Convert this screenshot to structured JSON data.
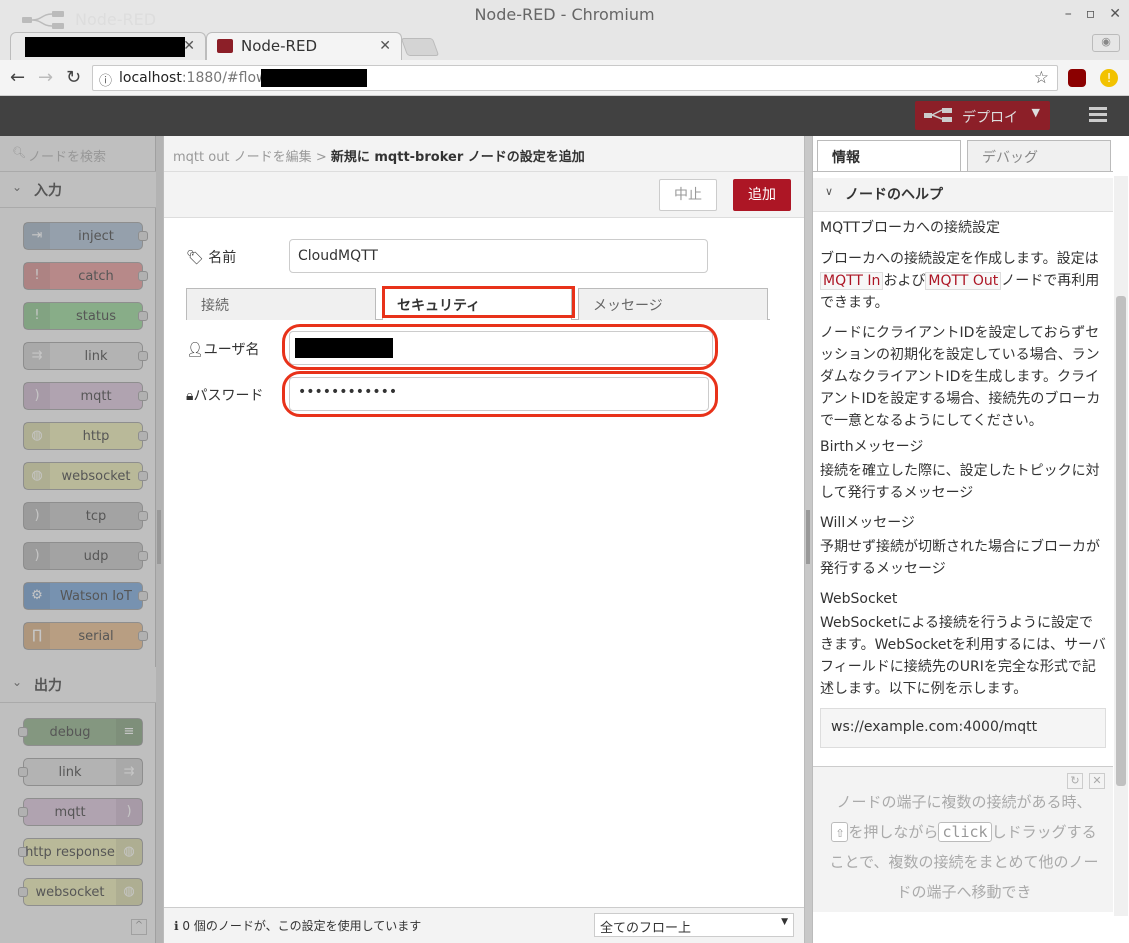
{
  "window": {
    "title": "Node-RED - Chromium"
  },
  "tabs": [
    {
      "label": ""
    },
    {
      "label": "Node-RED"
    }
  ],
  "address": {
    "url_host": "localhost",
    "url_rest": ":1880/#flow/"
  },
  "header": {
    "title": "Node-RED",
    "deploy_label": "デプロイ"
  },
  "palette": {
    "search_placeholder": "ノードを検索",
    "cat_input": "入力",
    "cat_output": "出力",
    "input_nodes": [
      "inject",
      "catch",
      "status",
      "link",
      "mqtt",
      "http",
      "websocket",
      "tcp",
      "udp",
      "Watson IoT",
      "serial"
    ],
    "output_nodes": [
      "debug",
      "link",
      "mqtt",
      "http response",
      "websocket"
    ]
  },
  "tray": {
    "breadcrumb_prev": "mqtt out ノードを編集",
    "breadcrumb_sep": ">",
    "breadcrumb_current": "新規に mqtt-broker ノードの設定を追加",
    "cancel_label": "中止",
    "add_label": "追加",
    "name_label": "名前",
    "name_value": "CloudMQTT",
    "tabs": [
      "接続",
      "セキュリティ",
      "メッセージ"
    ],
    "username_label": "ユーザ名",
    "password_label": "パスワード",
    "password_value": "••••••••••••",
    "footer_text": "0 個のノードが、この設定を使用しています",
    "scope_value": "全てのフロー上"
  },
  "sidebar": {
    "tab_info": "情報",
    "tab_debug": "デバッグ",
    "help_header": "ノードのヘルプ",
    "help_title": "MQTTブローカへの接続設定",
    "help_p1_a": "ブローカへの接続設定を作成します。設定は",
    "help_p1_code1": "MQTT In",
    "help_p1_b": "および",
    "help_p1_code2": "MQTT Out",
    "help_p1_c": "ノードで再利用できます。",
    "help_p2": "ノードにクライアントIDを設定しておらずセッションの初期化を設定している場合、ランダムなクライアントIDを生成します。クライアントIDを設定する場合、接続先のブローカで一意となるようにしてください。",
    "birth_title": "Birthメッセージ",
    "birth_text": "接続を確立した際に、設定したトピックに対して発行するメッセージ",
    "will_title": "Willメッセージ",
    "will_text": "予期せず接続が切断された場合にブローカが発行するメッセージ",
    "ws_title": "WebSocket",
    "ws_text": "WebSocketによる接続を行うように設定できます。WebSocketを利用するには、サーバフィールドに接続先のURIを完全な形式で記述します。以下に例を示します。",
    "ws_example": "ws://example.com:4000/mqtt",
    "tip_a": "ノードの端子に複数の接続がある時、",
    "tip_key1": "⇧",
    "tip_b": "を押しながら",
    "tip_key2": "click",
    "tip_c": "しドラッグすることで、複数の接続をまとめて他のノードの端子へ移動でき"
  },
  "colors": {
    "deploy": "#8c1f28",
    "add_button": "#ad1625",
    "highlight": "#e8321a",
    "header": "#414141"
  }
}
